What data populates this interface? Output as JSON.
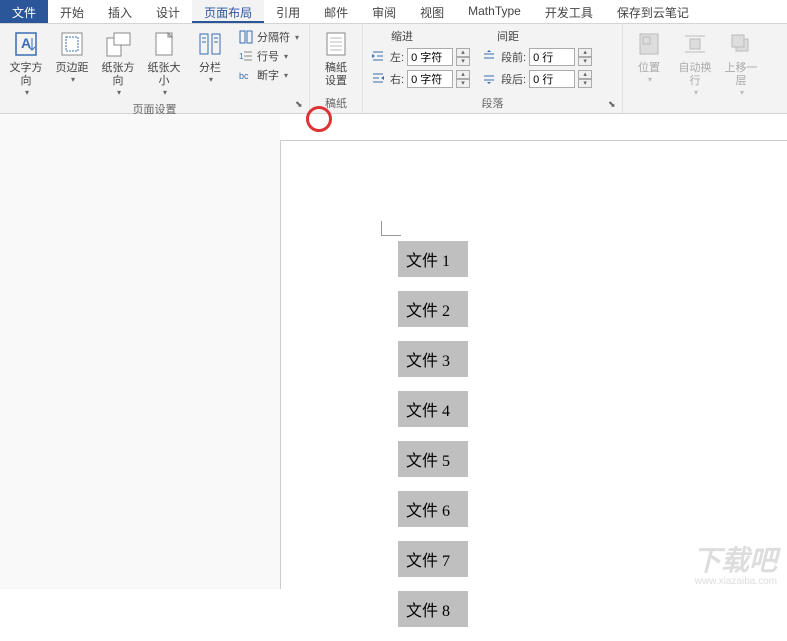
{
  "tabs": {
    "file": "文件",
    "home": "开始",
    "insert": "插入",
    "design": "设计",
    "layout": "页面布局",
    "references": "引用",
    "mailings": "邮件",
    "review": "审阅",
    "view": "视图",
    "mathtype": "MathType",
    "developer": "开发工具",
    "cloud": "保存到云笔记"
  },
  "page_setup": {
    "text_direction": "文字方向",
    "margins": "页边距",
    "orientation": "纸张方向",
    "size": "纸张大小",
    "columns": "分栏",
    "breaks": "分隔符",
    "line_numbers": "行号",
    "hyphenation": "断字",
    "group_label": "页面设置"
  },
  "manuscript": {
    "settings": "稿纸\n设置",
    "group_label": "稿纸"
  },
  "paragraph": {
    "indent_label": "缩进",
    "spacing_label": "间距",
    "left": "左:",
    "right": "右:",
    "before": "段前:",
    "after": "段后:",
    "left_val": "0 字符",
    "right_val": "0 字符",
    "before_val": "0 行",
    "after_val": "0 行",
    "group_label": "段落"
  },
  "arrange": {
    "position": "位置",
    "wrap": "自动换行",
    "forward": "上移一层"
  },
  "document": {
    "lines": [
      "文件 1",
      "文件 2",
      "文件 3",
      "文件 4",
      "文件 5",
      "文件 6",
      "文件 7",
      "文件 8"
    ]
  },
  "watermark": {
    "main": "下载吧",
    "sub": "www.xiazaiba.com"
  }
}
